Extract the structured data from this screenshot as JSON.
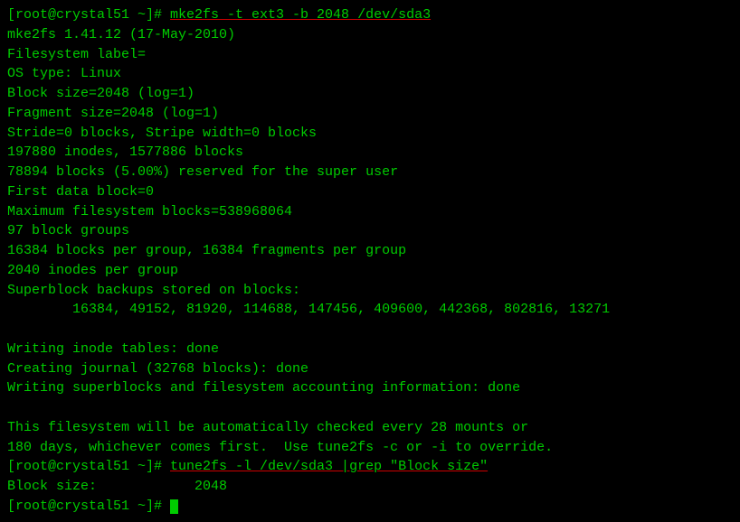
{
  "terminal": {
    "lines": [
      {
        "type": "prompt-command",
        "prompt": "[root@crystal51 ~]# ",
        "command": "mke2fs -t ext3 -b 2048 /dev/sda3",
        "underline": true
      },
      {
        "type": "output",
        "text": "mke2fs 1.41.12 (17-May-2010)"
      },
      {
        "type": "output",
        "text": "Filesystem label="
      },
      {
        "type": "output",
        "text": "OS type: Linux"
      },
      {
        "type": "output",
        "text": "Block size=2048 (log=1)"
      },
      {
        "type": "output",
        "text": "Fragment size=2048 (log=1)"
      },
      {
        "type": "output",
        "text": "Stride=0 blocks, Stripe width=0 blocks"
      },
      {
        "type": "output",
        "text": "197880 inodes, 1577886 blocks"
      },
      {
        "type": "output",
        "text": "78894 blocks (5.00%) reserved for the super user"
      },
      {
        "type": "output",
        "text": "First data block=0"
      },
      {
        "type": "output",
        "text": "Maximum filesystem blocks=538968064"
      },
      {
        "type": "output",
        "text": "97 block groups"
      },
      {
        "type": "output",
        "text": "16384 blocks per group, 16384 fragments per group"
      },
      {
        "type": "output",
        "text": "2040 inodes per group"
      },
      {
        "type": "output",
        "text": "Superblock backups stored on blocks:"
      },
      {
        "type": "output",
        "text": "        16384, 49152, 81920, 114688, 147456, 409600, 442368, 802816, 13271"
      },
      {
        "type": "output",
        "text": ""
      },
      {
        "type": "output",
        "text": "Writing inode tables: done"
      },
      {
        "type": "output",
        "text": "Creating journal (32768 blocks): done"
      },
      {
        "type": "output",
        "text": "Writing superblocks and filesystem accounting information: done"
      },
      {
        "type": "output",
        "text": ""
      },
      {
        "type": "output",
        "text": "This filesystem will be automatically checked every 28 mounts or"
      },
      {
        "type": "output",
        "text": "180 days, whichever comes first.  Use tune2fs -c or -i to override."
      },
      {
        "type": "prompt-command2",
        "prompt": "[root@crystal51 ~]# ",
        "command": "tune2fs -l /dev/sda3 |grep \"Block size\"",
        "underline": true
      },
      {
        "type": "output",
        "text": "Block size:\t\t2048"
      },
      {
        "type": "prompt-cursor",
        "prompt": "[root@crystal51 ~]# "
      }
    ]
  }
}
